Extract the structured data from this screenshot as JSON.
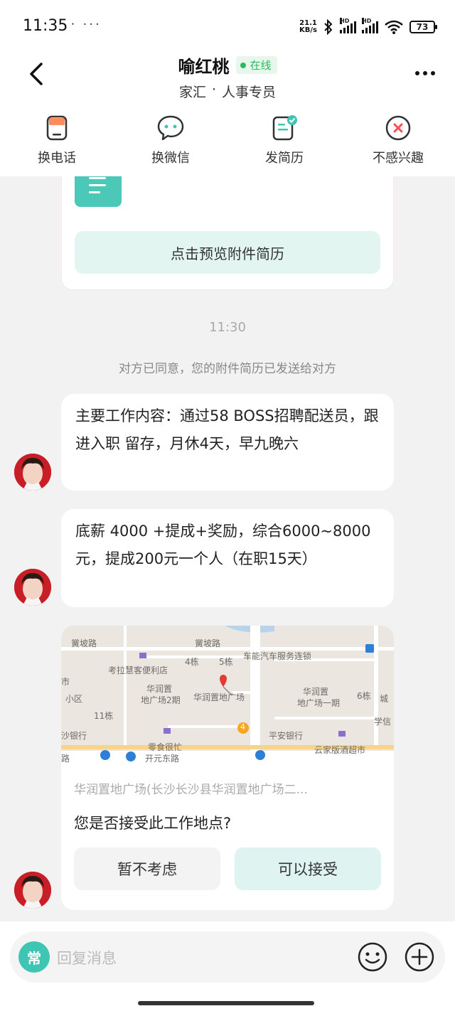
{
  "status_bar": {
    "time": "11:35",
    "dots": "⸱ ···",
    "net_speed_value": "21.1",
    "net_speed_unit": "KB/s",
    "hd1": "HD",
    "hd2": "HD",
    "battery": "73"
  },
  "header": {
    "name": "喻红桃",
    "online": "在线",
    "company": "家汇",
    "separator": "·",
    "position": "人事专员"
  },
  "actions": [
    {
      "label": "换电话",
      "icon": "phone-swap-icon"
    },
    {
      "label": "换微信",
      "icon": "wechat-icon"
    },
    {
      "label": "发简历",
      "icon": "resume-send-icon"
    },
    {
      "label": "不感兴趣",
      "icon": "not-interested-icon"
    }
  ],
  "chat": {
    "resume_preview_label": "点击预览附件简历",
    "timestamp": "11:30",
    "notice": "对方已同意，您的附件简历已发送给对方",
    "message1": "主要工作内容：通过58 BOSS招聘配送员，跟进入职 留存，月休4天，早九晚六",
    "message2": "底薪 4000 +提成+奖励，综合6000~8000元，提成200元一个人（在职15天）",
    "location": {
      "map_labels": {
        "l1": "黉坡路",
        "l2": "黉坡路",
        "l3": "车能汽车服务连锁",
        "l4": "考拉慧客便利店",
        "l5": "4栋",
        "l6": "5栋",
        "l7": "华润置",
        "l8": "地广场2期",
        "l9": "华润置地广场",
        "l10": "华润置",
        "l11": "地广场一期",
        "l12": "6栋",
        "l13": "小区",
        "l14": "11栋",
        "l15": "城",
        "l16": "沙银行",
        "l17": "零食很忙",
        "l18": "平安银行",
        "l19": "学信",
        "l20": "路",
        "l21": "开元东路",
        "l22": "云家版酒超市",
        "l23": "市",
        "l24": "4"
      },
      "address": "华润置地广场(长沙长沙县华润置地广场二...",
      "question": "您是否接受此工作地点?",
      "decline_label": "暂不考虑",
      "accept_label": "可以接受"
    }
  },
  "input_bar": {
    "quick_reply_label": "常",
    "placeholder": "回复消息"
  },
  "colors": {
    "accent_teal": "#3fc5b4",
    "online_green": "#2db863",
    "avatar_red": "#c81e28"
  }
}
